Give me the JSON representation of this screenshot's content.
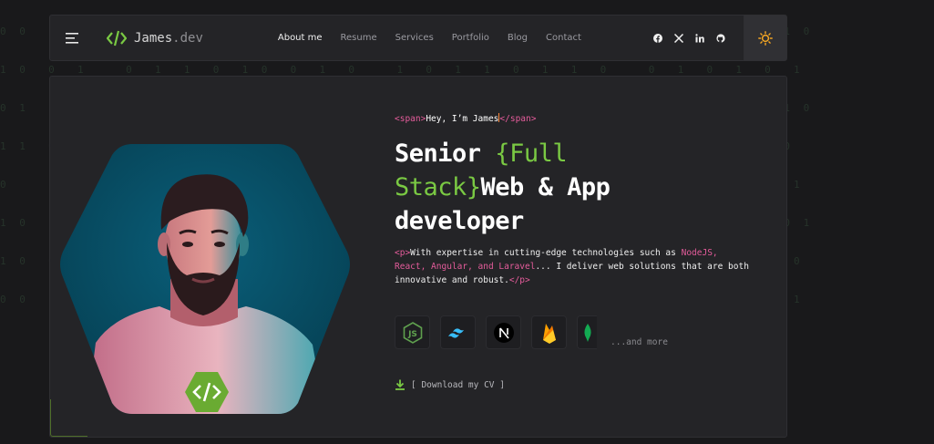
{
  "background": {
    "matrix_rows": [
      "0 0  1  1  0  1 1  0  0 1  0  1  1  0 0  1  0  1  1  0  1 0  0  1  1  0  1 0 1 0 1 0",
      "1 0  0  1    0  1  1  0  1 0  0  1  0    1  0  1  1  0  1  1  0    0  1  0  1  0  1",
      "0 1  1  0  0  1  0    1  1  0  1  0  0  1  1  0    1  0  0  1  1  0  1  0  0  1  1 0",
      "1 1  0  0  1  0  1  1  0    0  1  1  0  1  0  0  1  1    0  1  0  0  1  1  0  1  0",
      "0    1  0  1  1  0  0  1  1  0  1    0  0  1  1  0  1  0  0  1  1  0  1  0  0  1  1",
      "1 0  1  1  0  0  1  0  1  1    0  0  1  1  0  1  0  1  1  0    0  1  1  0  1  0  0 1",
      "1 0  0  1  1  0  1  0  0  1  1  0  1  0  0  1    1  0  1  1  0  0  1  0  1  1  0  0",
      "0 0  1  0  1  1  0  1  0  0  1  1  0  1  1  0  0  1  0  1  1  0  1  0  0  1  1  0 1"
    ]
  },
  "nav": {
    "logo_symbol": "</>",
    "logo_name": "James",
    "logo_suffix": ".dev",
    "links": [
      {
        "label": "About me",
        "active": true
      },
      {
        "label": "Resume",
        "active": false
      },
      {
        "label": "Services",
        "active": false
      },
      {
        "label": "Portfolio",
        "active": false
      },
      {
        "label": "Blog",
        "active": false
      },
      {
        "label": "Contact",
        "active": false
      }
    ],
    "socials": [
      "facebook-icon",
      "x-icon",
      "linkedin-icon",
      "github-icon"
    ],
    "theme_icon": "sun-icon"
  },
  "hero": {
    "intro_open": "<span>",
    "intro_text": "Hey, I’m James",
    "intro_close": "</span>",
    "headline_1": "Senior ",
    "headline_brace_open": "{",
    "headline_green": "Full Stack",
    "headline_brace_close": "}",
    "headline_2": "Web & App developer",
    "desc_open": "<p>",
    "desc_pre": "With expertise in cutting-edge technologies such as ",
    "desc_tech": "NodeJS, React, Angular, and Laravel",
    "desc_post": "... I deliver web solutions that are both innovative and robust.",
    "desc_close": "</p>",
    "tech_icons": [
      "nodejs-icon",
      "tailwind-icon",
      "nextjs-icon",
      "firebase-icon",
      "mongodb-icon"
    ],
    "more_label": "...and more",
    "download_label": "[ Download my CV ]",
    "badge_icon": "code-icon"
  },
  "colors": {
    "accent_green": "#7ac943",
    "tag_pink": "#e55c9b",
    "background": "#19191b",
    "card": "#242427",
    "sun": "#f5a623"
  }
}
